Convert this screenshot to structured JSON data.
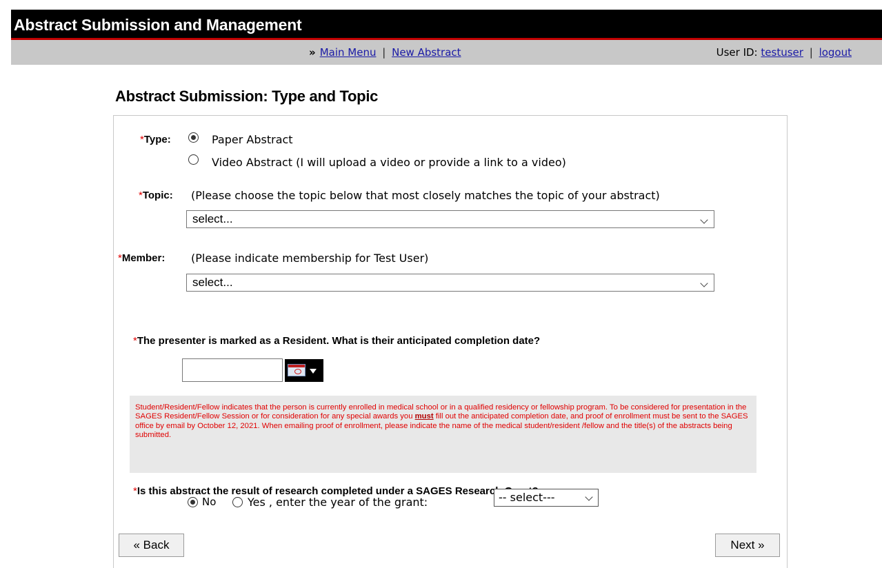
{
  "header": {
    "title": "Abstract Submission and Management"
  },
  "nav": {
    "raquo": "»",
    "main_menu": "Main Menu",
    "separator": "|",
    "new_abstract": "New Abstract",
    "user_label": "User ID:",
    "username": "testuser",
    "separator2": "|",
    "logout": "logout"
  },
  "page": {
    "title": "Abstract Submission: Type and Topic"
  },
  "form": {
    "required_mark": "*",
    "type": {
      "label": "Type:",
      "options": [
        "Paper Abstract",
        "Video Abstract (I will upload a video or provide a link to a video)"
      ],
      "selected": "Paper Abstract"
    },
    "topic": {
      "label": "Topic:",
      "hint": "(Please choose the topic below that most closely matches the topic of your abstract)",
      "value": "select..."
    },
    "member": {
      "label": "Member:",
      "hint": "(Please indicate membership for Test User)",
      "value": "select..."
    },
    "resident": {
      "question": "The presenter is marked as a Resident. What is their anticipated completion date?",
      "date_value": ""
    },
    "note": {
      "before_must": "Student/Resident/Fellow indicates that the person is currently enrolled in medical school or in a qualified residency or fellowship program. To be considered for presentation in the SAGES Resident/Fellow Session or for consideration for any special awards you",
      "must": "must",
      "after_must": "fill out the anticipated completion date, and proof of enrollment must be sent to the SAGES office by email by October 12, 2021. When emailing proof of enrollment, please indicate the name of the medical student/resident /fellow and the title(s) of the abstracts being submitted."
    },
    "grant": {
      "question": "Is this abstract the result of research completed under a SAGES Research Grant?",
      "no_label": "No",
      "yes_label": "Yes , enter the year of the grant:",
      "selected": "No",
      "year_value": "-- select---"
    }
  },
  "buttons": {
    "back": "« Back",
    "next": "Next »"
  }
}
